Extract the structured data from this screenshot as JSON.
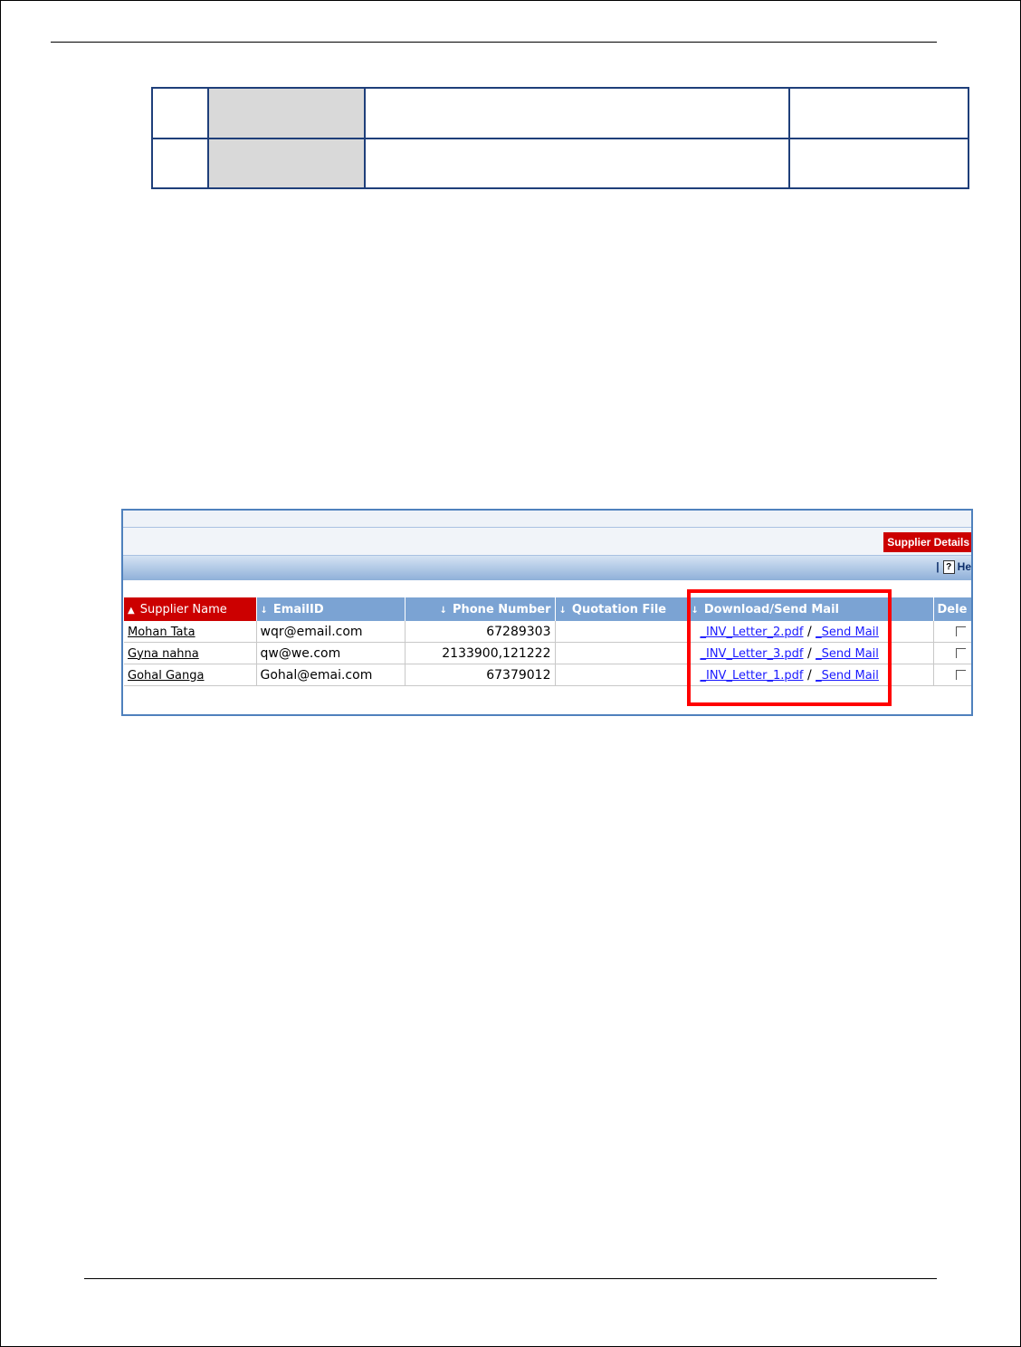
{
  "supplier_panel": {
    "tab_label": "Supplier Details",
    "help_separator": "|",
    "help_label": "He"
  },
  "grid": {
    "columns": [
      {
        "label": "Supplier Name",
        "sort_icon": "triangle-up-icon"
      },
      {
        "label": "EmailID",
        "sort_icon": "arrow-down-icon"
      },
      {
        "label": "Phone Number",
        "sort_icon": "arrow-down-icon"
      },
      {
        "label": "Quotation File",
        "sort_icon": "arrow-down-icon"
      },
      {
        "label": "Download/Send Mail",
        "sort_icon": "arrow-down-icon"
      },
      {
        "label": "Dele"
      }
    ],
    "rows": [
      {
        "name": "Mohan Tata",
        "email": "wqr@email.com",
        "phone": "67289303",
        "file": "",
        "download": "_INV_Letter_2.pdf",
        "sep": "/",
        "mail": "_Send Mail"
      },
      {
        "name": "Gyna nahna",
        "email": "qw@we.com",
        "phone": "2133900,121222",
        "file": "",
        "download": "_INV_Letter_3.pdf",
        "sep": "/",
        "mail": "_Send Mail"
      },
      {
        "name": "Gohal Ganga",
        "email": "Gohal@emai.com",
        "phone": "67379012",
        "file": "",
        "download": "_INV_Letter_1.pdf",
        "sep": "/",
        "mail": "_Send Mail"
      }
    ]
  },
  "colors": {
    "highlight": "#ff0000",
    "header": "#7ba3d3",
    "sorted_header": "#cc0000"
  }
}
